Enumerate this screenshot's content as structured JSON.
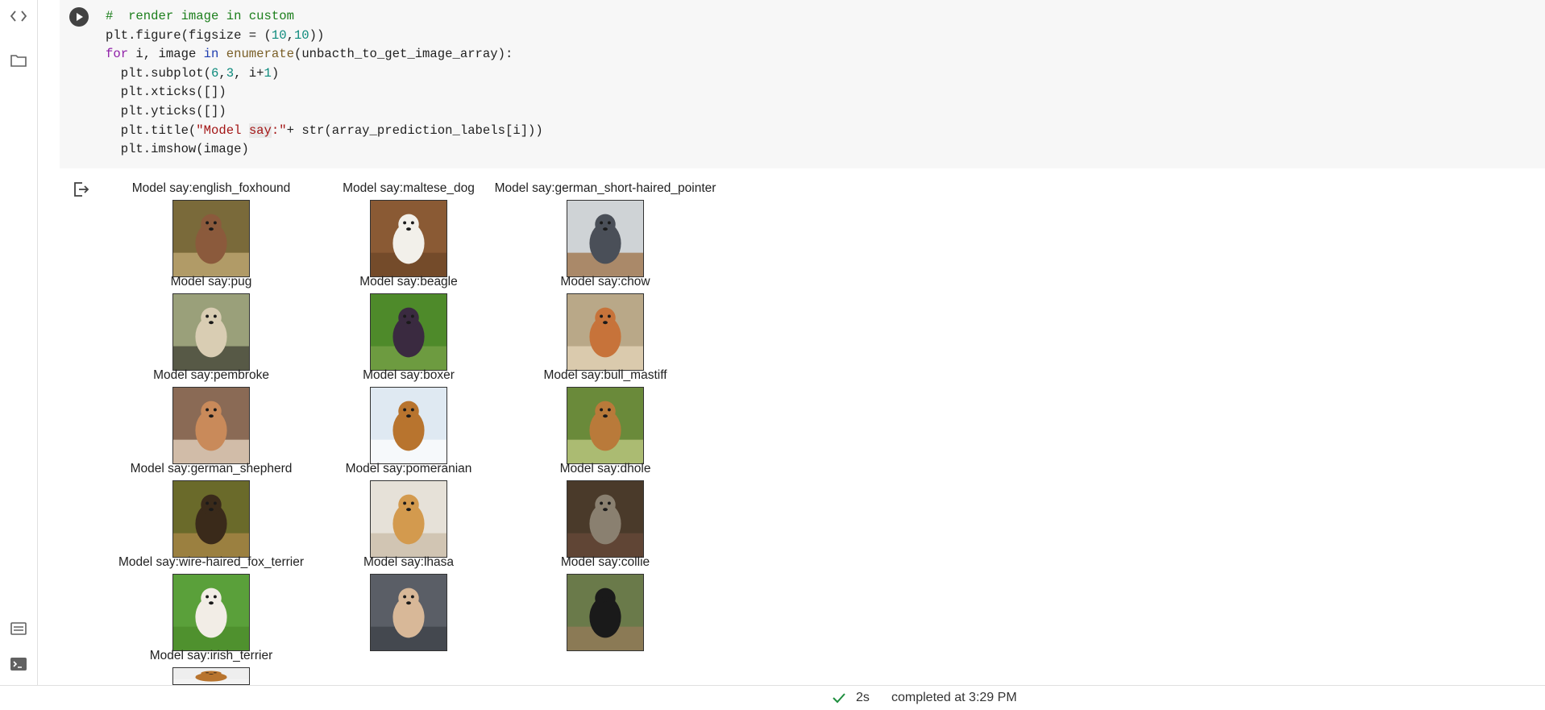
{
  "rail": {
    "items": [
      {
        "icon": "code-icon"
      },
      {
        "icon": "folder-icon"
      },
      {
        "icon": "command-palette-icon"
      },
      {
        "icon": "terminal-icon"
      }
    ]
  },
  "cell": {
    "code_lines": [
      "#  render image in custom",
      "plt.figure(figsize = (10,10))",
      "for i, image in enumerate(unbacth_to_get_image_array):",
      "  plt.subplot(6,3, i+1)",
      "  plt.xticks([])",
      "  plt.yticks([])",
      "  plt.title(\"Model say:\"+ str(array_prediction_labels[i]))",
      "  plt.imshow(image)"
    ]
  },
  "output": {
    "titles": [
      "Model say:english_foxhound",
      "Model say:maltese_dog",
      "Model say:german_short-haired_pointer",
      "Model say:pug",
      "Model say:beagle",
      "Model say:chow",
      "Model say:pembroke",
      "Model say:boxer",
      "Model say:bull_mastiff",
      "Model say:german_shepherd",
      "Model say:pomeranian",
      "Model say:dhole",
      "Model say:wire-haired_fox_terrier",
      "Model say:lhasa",
      "Model say:collie",
      "Model say:irish_terrier"
    ],
    "image_colors": [
      [
        "#7a6a3a",
        "#8b5a3c",
        "#c9b07a"
      ],
      [
        "#8a5a34",
        "#f2f0ea",
        "#6b4426"
      ],
      [
        "#cfd3d6",
        "#4a4f58",
        "#9a6a3a"
      ],
      [
        "#9aa07a",
        "#d9cdb3",
        "#3a3a30"
      ],
      [
        "#4e8a2a",
        "#3a2a40",
        "#7aa34a"
      ],
      [
        "#b9a888",
        "#c7733a",
        "#e8d9bd"
      ],
      [
        "#8a6a55",
        "#c98a5a",
        "#f0e0cc"
      ],
      [
        "#dfe9f2",
        "#b8742e",
        "#ffffff"
      ],
      [
        "#6a8a3a",
        "#b97a3a",
        "#c8d08a"
      ],
      [
        "#6a6a2a",
        "#3a2a1a",
        "#b08a4a"
      ],
      [
        "#e6e1d8",
        "#d39a4e",
        "#c7b9a4"
      ],
      [
        "#4a3a2a",
        "#8a8070",
        "#6a4a3a"
      ],
      [
        "#5aa03a",
        "#f2ede6",
        "#4a8a2a"
      ],
      [
        "#5a5e66",
        "#d8b898",
        "#3a3e46"
      ],
      [
        "#6a7a4a",
        "#1a1a1a",
        "#9a7a5a"
      ],
      [
        "#eeeeee",
        "#b8742e",
        "#f5f5f5"
      ]
    ]
  },
  "status": {
    "duration": "2s",
    "text": "completed at 3:29 PM"
  }
}
